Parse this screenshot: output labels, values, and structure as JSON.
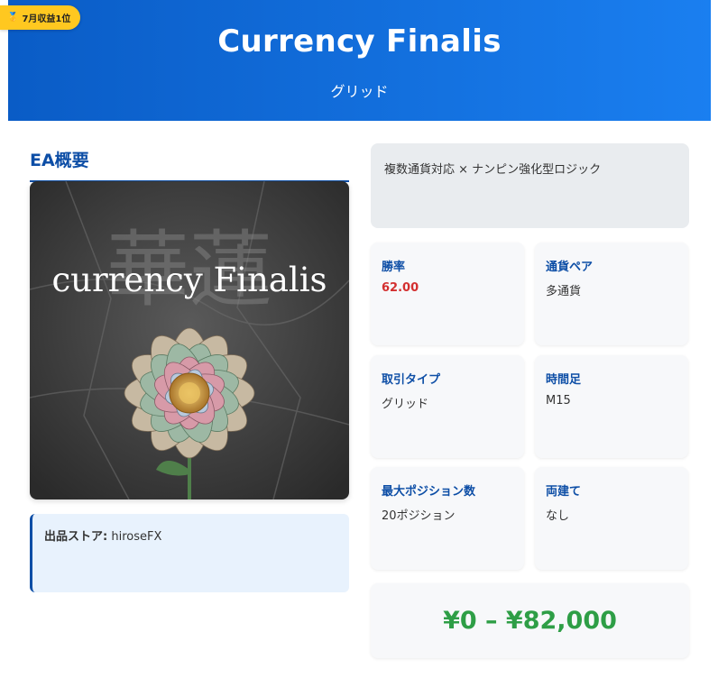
{
  "header": {
    "title": "Currency Finalis",
    "subtitle": "グリッド",
    "rank_badge": "7月収益1位",
    "rank_badge_icon": "medal-icon"
  },
  "overview": {
    "section_title": "EA概要",
    "image": {
      "logo_text": "currency Finalis",
      "background_glyphs": "華蓮"
    },
    "store": {
      "label": "出品ストア:",
      "value": "hiroseFX"
    }
  },
  "description": "複数通貨対応 × ナンピン強化型ロジック",
  "specs": [
    {
      "label": "勝率",
      "value": "62.00"
    },
    {
      "label": "通貨ペア",
      "value": "多通貨"
    },
    {
      "label": "取引タイプ",
      "value": "グリッド"
    },
    {
      "label": "時間足",
      "value": "M15"
    },
    {
      "label": "最大ポジション数",
      "value": "20ポジション"
    },
    {
      "label": "両建て",
      "value": "なし"
    }
  ],
  "price": "¥0 – ¥82,000",
  "colors": {
    "brand_blue": "#0d4ea6",
    "header_gradient_start": "#0a5cc6",
    "header_gradient_end": "#1a7ff0",
    "badge_yellow": "#ffc820",
    "win_rate_red": "#d32f2f",
    "price_green": "#2e9e46"
  }
}
